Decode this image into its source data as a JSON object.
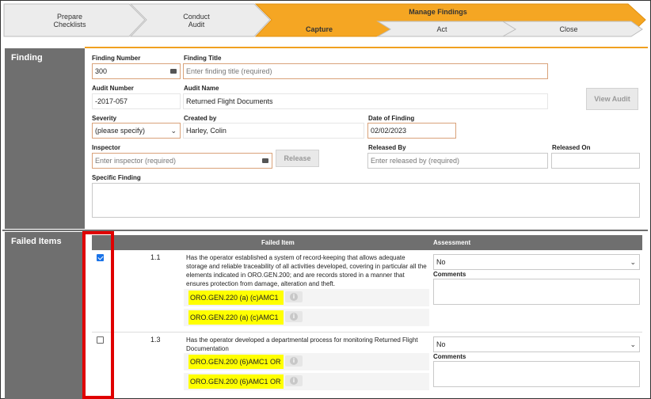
{
  "wizard": {
    "steps": [
      {
        "line1": "Prepare",
        "line2": "Checklists"
      },
      {
        "line1": "Conduct",
        "line2": "Audit"
      }
    ],
    "manage_findings": "Manage Findings",
    "substeps": [
      "Capture",
      "Act",
      "Close"
    ]
  },
  "finding": {
    "section_label": "Finding",
    "finding_number_label": "Finding Number",
    "finding_number_value": "300",
    "finding_title_label": "Finding Title",
    "finding_title_placeholder": "Enter finding title (required)",
    "audit_number_label": "Audit Number",
    "audit_number_value": "-2017-057",
    "audit_name_label": "Audit Name",
    "audit_name_value": "Returned Flight Documents",
    "view_audit_label": "View Audit",
    "severity_label": "Severity",
    "severity_value": "(please specify)",
    "created_by_label": "Created by",
    "created_by_value": "Harley, Colin",
    "date_label": "Date of Finding",
    "date_value": "02/02/2023",
    "inspector_label": "Inspector",
    "inspector_placeholder": "Enter inspector (required)",
    "release_label": "Release",
    "released_by_label": "Released By",
    "released_by_placeholder": "Enter released by (required)",
    "released_on_label": "Released On",
    "specific_finding_label": "Specific Finding"
  },
  "failed_items": {
    "section_label": "Failed Items",
    "col_failed_item": "Failed Item",
    "col_assessment": "Assessment",
    "comments_label": "Comments",
    "rows": [
      {
        "checked": true,
        "number": "1.1",
        "text": "Has the operator established a system of record-keeping that allows adequate storage and reliable traceability of all activities developed, covering in particular all the elements indicated in ORO.GEN.200; and are records stored in a manner that ensures protection from damage, alteration and theft.",
        "refs": [
          "ORO.GEN.220 (a) (c)AMC1",
          "ORO.GEN.220 (a) (c)AMC1"
        ],
        "assessment": "No"
      },
      {
        "checked": false,
        "number": "1.3",
        "text": "Has the operator developed a departmental process for monitoring Returned Flight Documentation",
        "refs": [
          "ORO.GEN.200 (6)AMC1 OR",
          "ORO.GEN.200 (6)AMC1 OR"
        ],
        "assessment": "No"
      }
    ]
  }
}
